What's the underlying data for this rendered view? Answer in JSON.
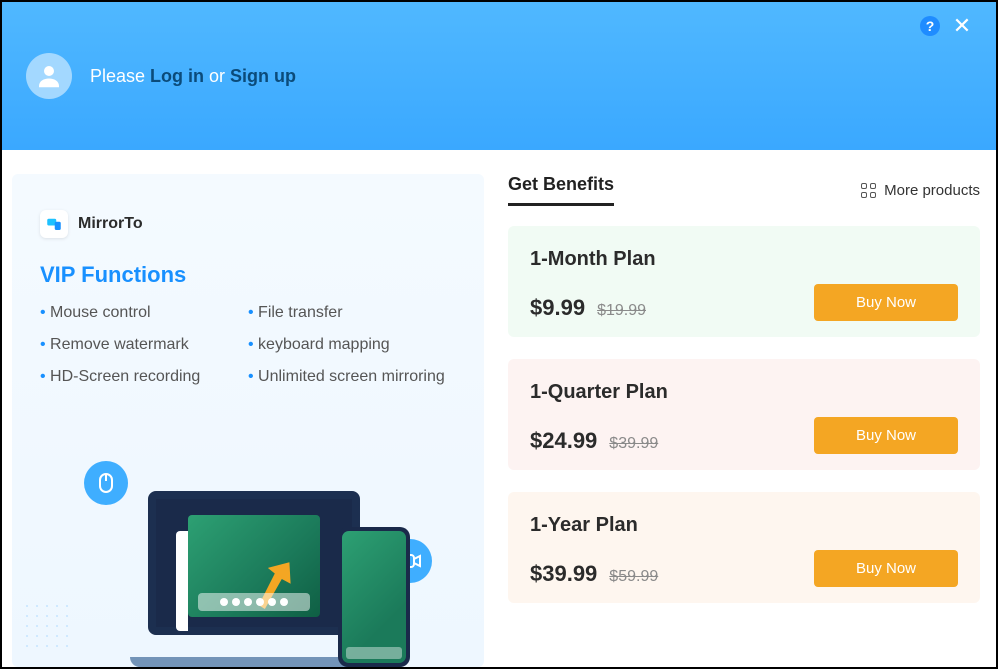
{
  "header": {
    "please": "Please ",
    "login": "Log in",
    "or": " or ",
    "signup": "Sign up",
    "help": "?",
    "close": "✕"
  },
  "left": {
    "app_name": "MirrorTo",
    "vip_title": "VIP Functions",
    "features": [
      "Mouse control",
      "File transfer",
      "Remove watermark",
      "keyboard mapping",
      "HD-Screen recording",
      "Unlimited screen mirroring"
    ]
  },
  "right": {
    "tab": "Get Benefits",
    "more": "More products",
    "plans": [
      {
        "title": "1-Month Plan",
        "price": "$9.99",
        "old": "$19.99",
        "cta": "Buy Now"
      },
      {
        "title": "1-Quarter Plan",
        "price": "$24.99",
        "old": "$39.99",
        "cta": "Buy Now"
      },
      {
        "title": "1-Year Plan",
        "price": "$39.99",
        "old": "$59.99",
        "cta": "Buy Now"
      }
    ]
  }
}
